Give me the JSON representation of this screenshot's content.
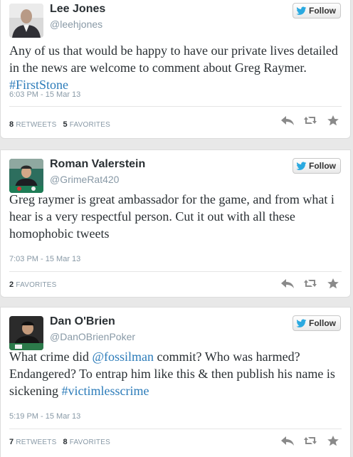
{
  "colors": {
    "link": "#2b7bb9",
    "name": "#292f33",
    "muted": "#8899a6",
    "twitter_bird": "#2aa9e0",
    "action_icon": "#8a8a8a"
  },
  "tweets": [
    {
      "name": "Lee Jones",
      "handle": "@leehjones",
      "follow_label": "Follow",
      "text_plain": "Any of us that would be happy to have our private lives detailed in the news are welcome to comment about Greg Raymer. ",
      "hashtag": "#FirstStone",
      "timestamp": "6:03 PM - 15 Mar 13",
      "retweets_count": "8",
      "retweets_label": "RETWEETS",
      "favorites_count": "5",
      "favorites_label": "FAVORITES",
      "avatar_icon": "person-photo-icon"
    },
    {
      "name": "Roman Valerstein",
      "handle": "@GrimeRat420",
      "follow_label": "Follow",
      "text_plain": "Greg raymer is great ambassador for the game, and from what i hear is a very respectful person. Cut it out with all these homophobic tweets",
      "timestamp": "7:03 PM - 15 Mar 13",
      "favorites_count": "2",
      "favorites_label": "FAVORITES",
      "avatar_icon": "poker-player-photo-icon"
    },
    {
      "name": "Dan O'Brien",
      "handle": "@DanOBrienPoker",
      "follow_label": "Follow",
      "text_before_mention": "What crime did ",
      "mention": "@fossilman",
      "text_after_mention": " commit? Who was harmed? Endangered? To entrap him like this & then publish his name is sickening ",
      "hashtag": "#victimlesscrime",
      "timestamp": "5:19 PM - 15 Mar 13",
      "retweets_count": "7",
      "retweets_label": "RETWEETS",
      "favorites_count": "8",
      "favorites_label": "FAVORITES",
      "avatar_icon": "poker-table-photo-icon"
    }
  ]
}
